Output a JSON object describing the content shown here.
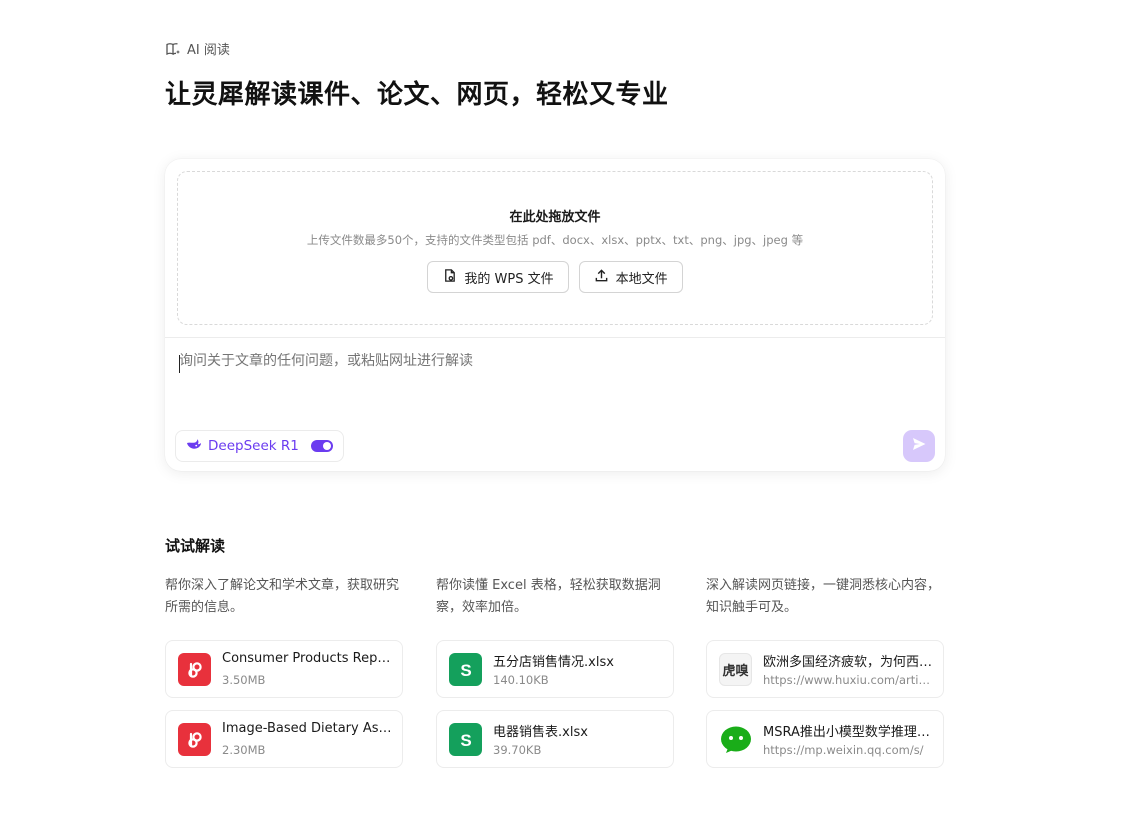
{
  "breadcrumb": {
    "label": "AI 阅读"
  },
  "headline": "让灵犀解读课件、论文、网页，轻松又专业",
  "upload": {
    "title": "在此处拖放文件",
    "subtitle": "上传文件数最多50个，支持的文件类型包括 pdf、docx、xlsx、pptx、txt、png、jpg、jpeg 等",
    "wps_button": "我的 WPS 文件",
    "local_button": "本地文件"
  },
  "prompt": {
    "placeholder": "询问关于文章的任何问题，或粘贴网址进行解读"
  },
  "model": {
    "label": "DeepSeek R1",
    "enabled": true
  },
  "colors": {
    "accent": "#6b3cf0",
    "send_disabled": "#d7c8fb",
    "pdf": "#e8313c",
    "excel": "#14a05c",
    "wechat": "#1aad19"
  },
  "try": {
    "title": "试试解读",
    "columns": [
      {
        "description": "帮你深入了解论文和学术文章，获取研究所需的信息。",
        "items": [
          {
            "name": "Consumer Products Report",
            "meta": "3.50MB",
            "icon": "pdf-icon"
          },
          {
            "name": "Image-Based Dietary Assessment",
            "meta": "2.30MB",
            "icon": "pdf-icon"
          }
        ]
      },
      {
        "description": "帮你读懂 Excel 表格，轻松获取数据洞察，效率加倍。",
        "items": [
          {
            "name": "五分店销售情况.xlsx",
            "meta": "140.10KB",
            "icon": "excel-icon"
          },
          {
            "name": "电器销售表.xlsx",
            "meta": "39.70KB",
            "icon": "excel-icon"
          }
        ]
      },
      {
        "description": "深入解读网页链接，一键洞悉核心内容，知识触手可及。",
        "items": [
          {
            "name": "欧洲多国经济疲软，为何西班牙一枝独秀",
            "meta": "https://www.huxiu.com/article/",
            "icon": "huxiu-icon",
            "icon_text": "虎嗅"
          },
          {
            "name": "MSRA推出小模型数学推理新方法",
            "meta": "https://mp.weixin.qq.com/s/",
            "icon": "wechat-icon"
          }
        ]
      }
    ]
  }
}
